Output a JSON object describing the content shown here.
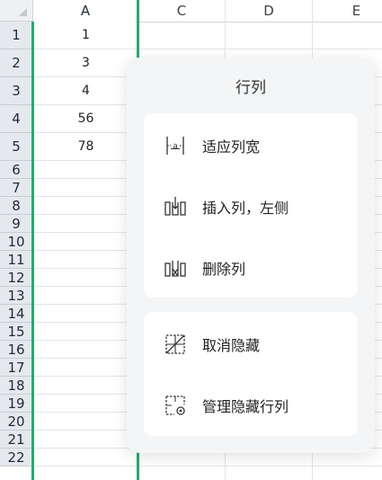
{
  "columns": [
    "A",
    "C",
    "D",
    "E"
  ],
  "rows": [
    "1",
    "2",
    "3",
    "4",
    "5",
    "6",
    "7",
    "8",
    "9",
    "10",
    "11",
    "12",
    "13",
    "14",
    "15",
    "16",
    "17",
    "18",
    "19",
    "20",
    "21",
    "22"
  ],
  "cells_a": [
    "1",
    "3",
    "4",
    "56",
    "78"
  ],
  "accent": "#1fae6d",
  "menu": {
    "title": "行列",
    "group1": [
      {
        "label": "适应列宽",
        "icon": "fit-column-width-icon"
      },
      {
        "label": "插入列，左侧",
        "icon": "insert-column-left-icon"
      },
      {
        "label": "删除列",
        "icon": "delete-column-icon"
      }
    ],
    "group2": [
      {
        "label": "取消隐藏",
        "icon": "unhide-icon"
      },
      {
        "label": "管理隐藏行列",
        "icon": "manage-hidden-icon"
      }
    ]
  }
}
